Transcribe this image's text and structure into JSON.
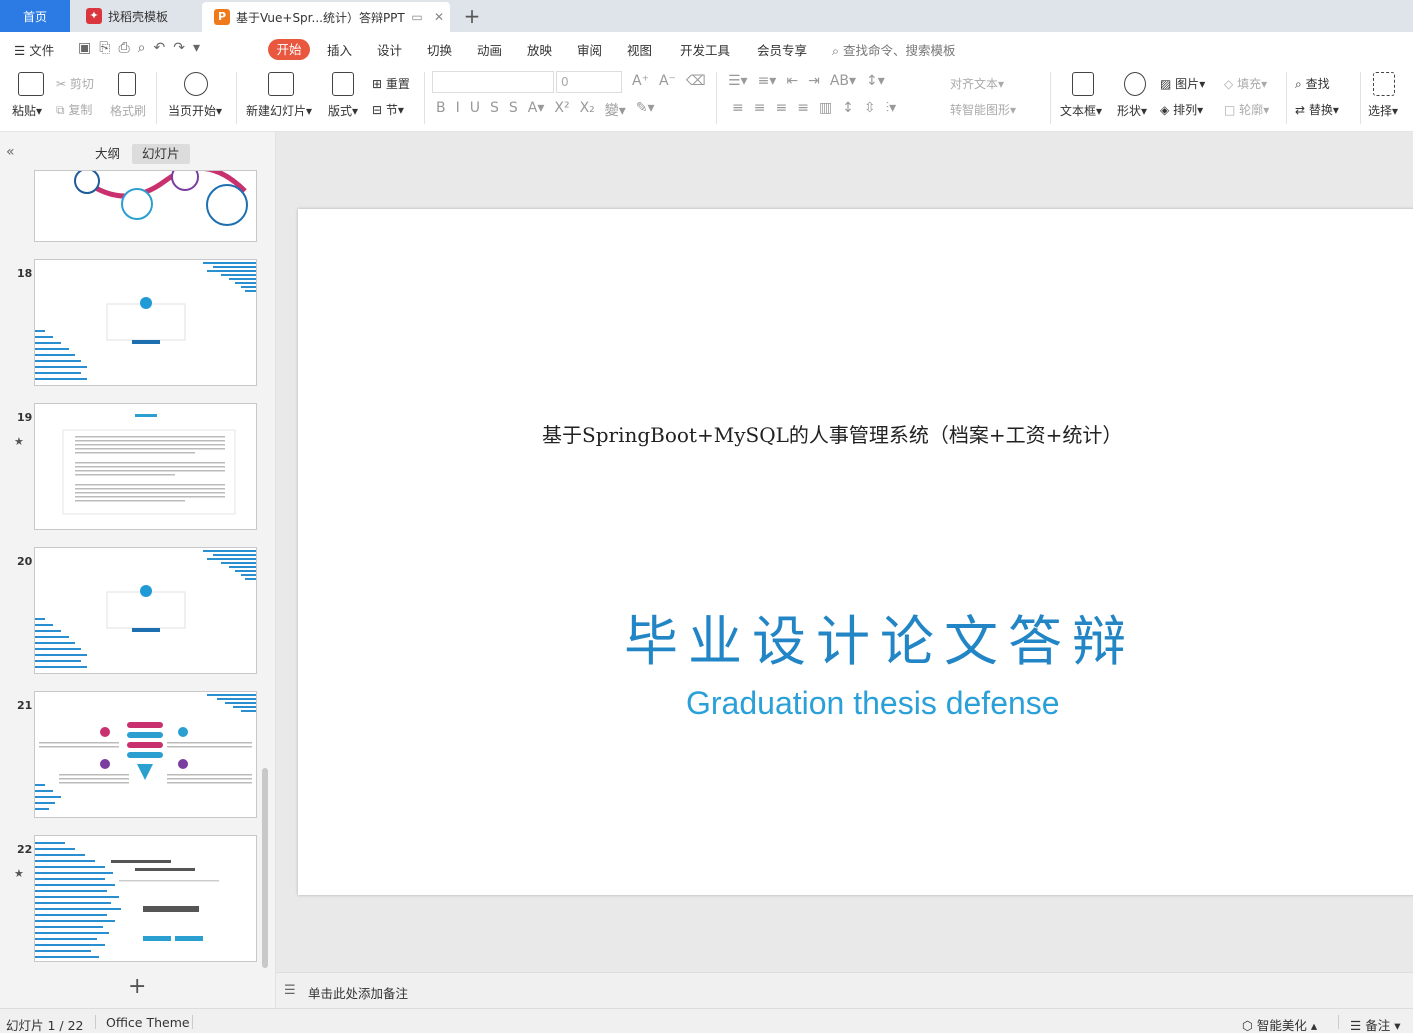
{
  "tabs": {
    "home": "首页",
    "daoke": "找稻壳模板",
    "active": "基于Vue+Spr...统计）答辩PPT"
  },
  "menu": {
    "file": "文件",
    "start": "开始",
    "insert": "插入",
    "design": "设计",
    "switch": "切换",
    "animation": "动画",
    "play": "放映",
    "review": "审阅",
    "view": "视图",
    "devtools": "开发工具",
    "member": "会员专享",
    "search": "查找命令、搜索模板"
  },
  "ribbon": {
    "paste": "粘贴",
    "cut": "剪切",
    "copy": "复制",
    "format_painter": "格式刷",
    "from_current": "当页开始",
    "new_slide": "新建幻灯片",
    "layout": "版式",
    "reset": "重置",
    "section": "节",
    "font_size": "0",
    "align_text": "对齐文本",
    "smart_shape": "转智能图形",
    "textbox": "文本框",
    "shape": "形状",
    "picture": "图片",
    "arrange": "排列",
    "fill": "填充",
    "outline": "轮廓",
    "find": "查找",
    "replace": "替换",
    "select": "选择"
  },
  "left_panel": {
    "tab_outline": "大纲",
    "tab_slides": "幻灯片",
    "slides": [
      {
        "num": "18"
      },
      {
        "num": "19"
      },
      {
        "num": "20"
      },
      {
        "num": "21"
      },
      {
        "num": "22"
      }
    ]
  },
  "slide": {
    "subtitle": "基于SpringBoot+MySQL的人事管理系统（档案+工资+统计）",
    "title": "毕业设计论文答辩",
    "title_en": "Graduation thesis defense"
  },
  "notes": {
    "placeholder": "单击此处添加备注"
  },
  "status": {
    "slide_count": "幻灯片 1 / 22",
    "theme": "Office Theme",
    "beautify": "智能美化",
    "notes": "备注"
  },
  "colors": {
    "accent": "#2c7be5",
    "start_tab": "#e9573f",
    "title_blue": "#2285c5",
    "en_blue": "#29a0d8"
  }
}
